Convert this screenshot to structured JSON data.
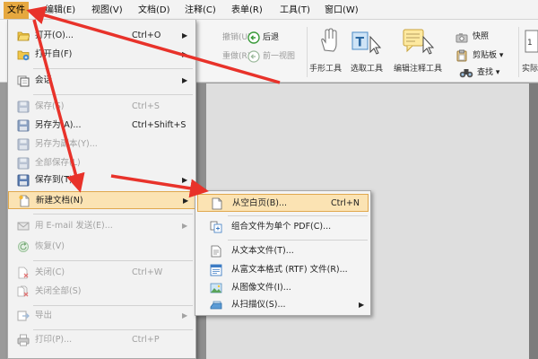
{
  "menubar": {
    "items": [
      {
        "label": "文件"
      },
      {
        "label": "编辑(E)"
      },
      {
        "label": "视图(V)"
      },
      {
        "label": "文档(D)"
      },
      {
        "label": "注释(C)"
      },
      {
        "label": "表单(R)"
      },
      {
        "label": "工具(T)"
      },
      {
        "label": "窗口(W)"
      }
    ]
  },
  "toolbar": {
    "undo": "撤销(U)",
    "back": "后退",
    "redo": "重做(R)",
    "prev_view": "前一视图",
    "hand_tool": "手形工具",
    "select_tool": "选取工具",
    "edit_annot_tool": "编辑注释工具",
    "snapshot": "快照",
    "clipboard": "剪贴板",
    "find": "查找",
    "actual": "实际"
  },
  "file_menu": {
    "items": [
      {
        "label": "打开(O)...",
        "shortcut": "Ctrl+O",
        "submenu": true
      },
      {
        "label": "打开自(F)",
        "submenu": true
      },
      {
        "label": "会话",
        "submenu": true
      },
      {
        "label": "保存(S)",
        "shortcut": "Ctrl+S"
      },
      {
        "label": "另存为(A)...",
        "shortcut": "Ctrl+Shift+S"
      },
      {
        "label": "另存为副本(Y)..."
      },
      {
        "label": "全部保存(L)"
      },
      {
        "label": "保存到(T)",
        "submenu": true
      },
      {
        "label": "新建文档(N)",
        "submenu": true
      },
      {
        "label": "用 E-mail 发送(E)...",
        "submenu": true
      },
      {
        "label": "恢复(V)"
      },
      {
        "label": "关闭(C)",
        "shortcut": "Ctrl+W"
      },
      {
        "label": "关闭全部(S)"
      },
      {
        "label": "导出",
        "submenu": true
      },
      {
        "label": "打印(P)...",
        "shortcut": "Ctrl+P"
      }
    ]
  },
  "new_submenu": {
    "items": [
      {
        "label": "从空白页(B)...",
        "shortcut": "Ctrl+N"
      },
      {
        "label": "组合文件为单个 PDF(C)..."
      },
      {
        "label": "从文本文件(T)..."
      },
      {
        "label": "从富文本格式 (RTF) 文件(R)..."
      },
      {
        "label": "从图像文件(I)..."
      },
      {
        "label": "从扫描仪(S)...",
        "submenu": true
      }
    ]
  },
  "glyphs": {
    "arrow": "▶",
    "dropdown": "▾"
  },
  "colors": {
    "accent_highlight": "#fbe3b3",
    "accent_border": "#e0a84e",
    "menubar_active": "#e6a83f",
    "annotation_arrow": "#e8322a",
    "disabled_text": "#a2a2a2"
  }
}
